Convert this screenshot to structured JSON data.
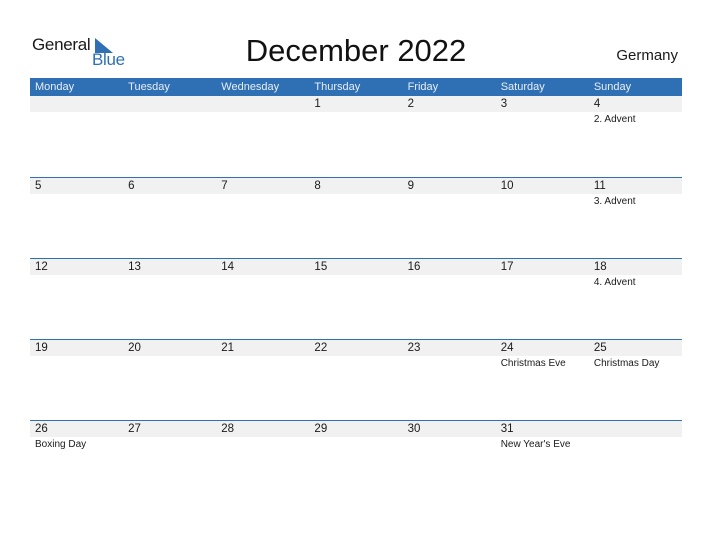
{
  "logo": {
    "part1": "General",
    "part2": "Blue"
  },
  "title": "December 2022",
  "country": "Germany",
  "colors": {
    "accent": "#2f70b5",
    "day_bar": "#f1f1f1"
  },
  "weekdays": [
    "Monday",
    "Tuesday",
    "Wednesday",
    "Thursday",
    "Friday",
    "Saturday",
    "Sunday"
  ],
  "weeks": [
    [
      {
        "day": "",
        "event": ""
      },
      {
        "day": "",
        "event": ""
      },
      {
        "day": "",
        "event": ""
      },
      {
        "day": "1",
        "event": ""
      },
      {
        "day": "2",
        "event": ""
      },
      {
        "day": "3",
        "event": ""
      },
      {
        "day": "4",
        "event": "2. Advent"
      }
    ],
    [
      {
        "day": "5",
        "event": ""
      },
      {
        "day": "6",
        "event": ""
      },
      {
        "day": "7",
        "event": ""
      },
      {
        "day": "8",
        "event": ""
      },
      {
        "day": "9",
        "event": ""
      },
      {
        "day": "10",
        "event": ""
      },
      {
        "day": "11",
        "event": "3. Advent"
      }
    ],
    [
      {
        "day": "12",
        "event": ""
      },
      {
        "day": "13",
        "event": ""
      },
      {
        "day": "14",
        "event": ""
      },
      {
        "day": "15",
        "event": ""
      },
      {
        "day": "16",
        "event": ""
      },
      {
        "day": "17",
        "event": ""
      },
      {
        "day": "18",
        "event": "4. Advent"
      }
    ],
    [
      {
        "day": "19",
        "event": ""
      },
      {
        "day": "20",
        "event": ""
      },
      {
        "day": "21",
        "event": ""
      },
      {
        "day": "22",
        "event": ""
      },
      {
        "day": "23",
        "event": ""
      },
      {
        "day": "24",
        "event": "Christmas Eve"
      },
      {
        "day": "25",
        "event": "Christmas Day"
      }
    ],
    [
      {
        "day": "26",
        "event": "Boxing Day"
      },
      {
        "day": "27",
        "event": ""
      },
      {
        "day": "28",
        "event": ""
      },
      {
        "day": "29",
        "event": ""
      },
      {
        "day": "30",
        "event": ""
      },
      {
        "day": "31",
        "event": "New Year's Eve"
      },
      {
        "day": "",
        "event": ""
      }
    ]
  ]
}
